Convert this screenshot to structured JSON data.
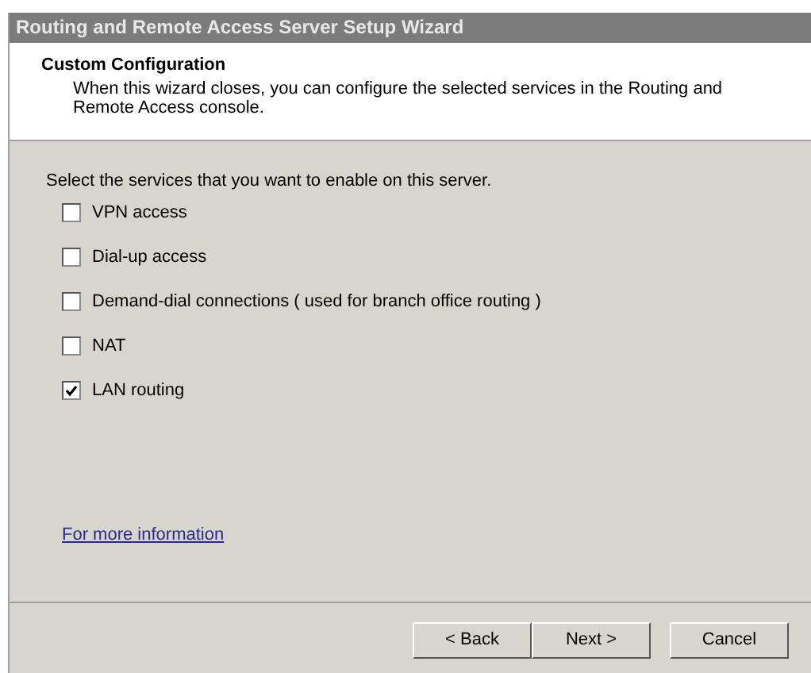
{
  "window": {
    "title": "Routing and Remote Access Server Setup Wizard"
  },
  "header": {
    "title": "Custom Configuration",
    "description": "When this wizard closes, you can configure the selected services in the Routing and Remote Access console."
  },
  "prompt": "Select the services that you want to enable on this server.",
  "services": [
    {
      "label": "VPN access",
      "checked": false
    },
    {
      "label": "Dial-up access",
      "checked": false
    },
    {
      "label": "Demand-dial connections ( used for branch office routing )",
      "checked": false
    },
    {
      "label": "NAT",
      "checked": false
    },
    {
      "label": "LAN routing",
      "checked": true
    }
  ],
  "link": "For more information",
  "buttons": [
    {
      "label": "< Back",
      "kind": "back"
    },
    {
      "label": "Next >",
      "kind": "next"
    },
    {
      "label": "Cancel",
      "kind": "cancel"
    }
  ]
}
